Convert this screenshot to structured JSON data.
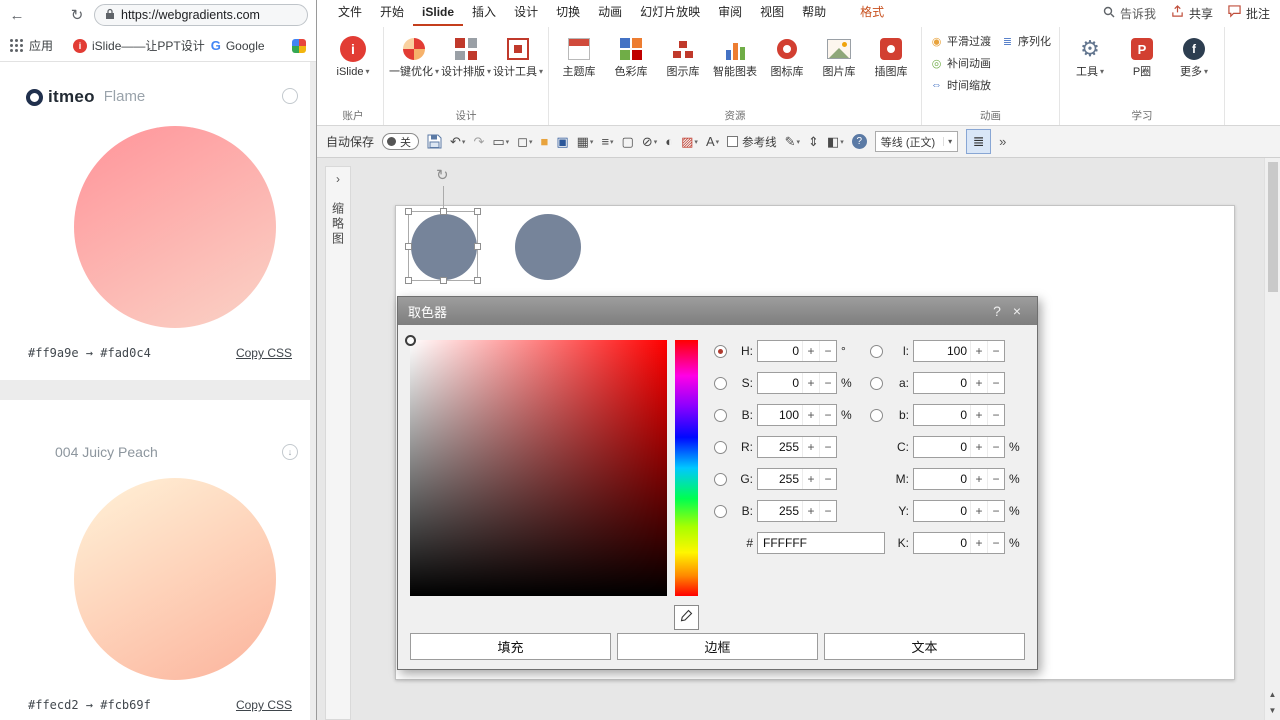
{
  "glyphs": {
    "dropdown": "▾",
    "back": "←",
    "refresh": "↻",
    "chevron": "›",
    "down_arrow": "↓",
    "rotate": "↻",
    "more": "»",
    "scroll_up": "▲",
    "scroll_down": "▼"
  },
  "browser": {
    "url": "https://webgradients.com",
    "bookmarks": {
      "apps": "应用",
      "islide": "iSlide——让PPT设计",
      "google": "Google",
      "google_letter": "G"
    },
    "header": {
      "logo": "itmeo",
      "peek_title": "Warm Flame"
    },
    "cards": [
      {
        "range": "#ff9a9e → #fad0c4",
        "copy": "Copy CSS",
        "from": "#ff9a9e",
        "to": "#fad0c4"
      },
      {
        "title": "004 Juicy Peach",
        "range": "#ffecd2 → #fcb69f",
        "copy": "Copy CSS",
        "from": "#ffecd2",
        "to": "#fcb69f"
      }
    ]
  },
  "ppt": {
    "tabs": [
      "文件",
      "开始",
      "iSlide",
      "插入",
      "设计",
      "切换",
      "动画",
      "幻灯片放映",
      "审阅",
      "视图",
      "帮助",
      "格式"
    ],
    "tell_me": "告诉我",
    "share": "共享",
    "comments": "批注",
    "ribbon": {
      "account": {
        "item": "iSlide",
        "label": "账户"
      },
      "design": {
        "items": [
          "一键优化",
          "设计排版",
          "设计工具"
        ],
        "label": "设计"
      },
      "resources": {
        "items": [
          "主题库",
          "色彩库",
          "图示库",
          "智能图表",
          "图标库",
          "图片库",
          "插图库"
        ],
        "label": "资源"
      },
      "animation": {
        "items": [
          "平滑过渡",
          "序列化",
          "补间动画",
          "时间缩放"
        ],
        "label": "动画"
      },
      "learn": {
        "items": [
          "工具",
          "P圈",
          "更多"
        ],
        "label": "学习"
      }
    },
    "qat": {
      "autosave": "自动保存",
      "autosave_state": "关",
      "guides": "参考线",
      "font": "等线 (正文)",
      "glyphs": {
        "undo": "↶",
        "redo": "↷",
        "pen": "✎",
        "row_height": "⇕",
        "shading": "◧",
        "paragraph": "≣",
        "help": "?"
      },
      "icons": [
        {
          "name": "new-slide",
          "glyph": "▭"
        },
        {
          "name": "shapes",
          "glyph": "◻"
        },
        {
          "name": "fill-color",
          "glyph": "■"
        },
        {
          "name": "arrange-windows",
          "glyph": "▣"
        },
        {
          "name": "table",
          "glyph": "▦"
        },
        {
          "name": "align-objects",
          "glyph": "≡"
        },
        {
          "name": "text-box",
          "glyph": "▢"
        },
        {
          "name": "no-fill",
          "glyph": "⊘"
        },
        {
          "name": "contrast",
          "glyph": "◐"
        },
        {
          "name": "pattern",
          "glyph": "▨"
        },
        {
          "name": "font-frame",
          "glyph": "A"
        }
      ]
    },
    "thumbnail_panel": "缩略图"
  },
  "dialog": {
    "title": "取色器",
    "help": "?",
    "close": "×",
    "plus": "+",
    "minus": "−",
    "col1": [
      {
        "label": "H:",
        "value": "0",
        "unit": "°"
      },
      {
        "label": "S:",
        "value": "0",
        "unit": "%"
      },
      {
        "label": "B:",
        "value": "100",
        "unit": "%"
      },
      {
        "label": "R:",
        "value": "255",
        "unit": ""
      },
      {
        "label": "G:",
        "value": "255",
        "unit": ""
      },
      {
        "label": "B:",
        "value": "255",
        "unit": ""
      }
    ],
    "hex_label": "#",
    "hex": "FFFFFF",
    "col2": [
      {
        "label": "l:",
        "value": "100",
        "unit": ""
      },
      {
        "label": "a:",
        "value": "0",
        "unit": ""
      },
      {
        "label": "b:",
        "value": "0",
        "unit": ""
      },
      {
        "label": "C:",
        "value": "0",
        "unit": "%"
      },
      {
        "label": "M:",
        "value": "0",
        "unit": "%"
      },
      {
        "label": "Y:",
        "value": "0",
        "unit": "%"
      },
      {
        "label": "K:",
        "value": "0",
        "unit": "%"
      }
    ],
    "buttons": [
      "填充",
      "边框",
      "文本"
    ]
  },
  "colors": {
    "accent": "#c8501e",
    "shape_fill": "#76849a"
  }
}
